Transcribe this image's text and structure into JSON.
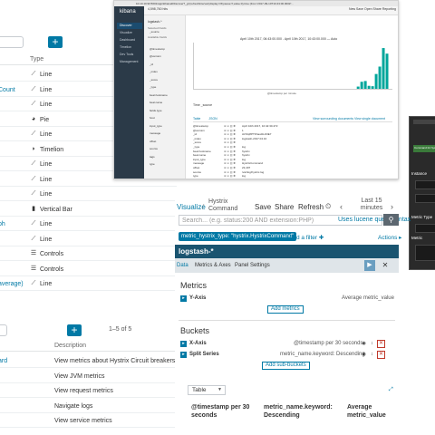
{
  "left_panel": {
    "column_type": "Type",
    "rows": [
      {
        "name": "",
        "type": "Line",
        "icon": "line-chart-icon"
      },
      {
        "name": "Count",
        "type": "Line",
        "icon": "line-chart-icon"
      },
      {
        "name": "",
        "type": "Line",
        "icon": "line-chart-icon"
      },
      {
        "name": "",
        "type": "Pie",
        "icon": "pie-chart-icon"
      },
      {
        "name": "",
        "type": "Line",
        "icon": "line-chart-icon"
      },
      {
        "name": "",
        "type": "Timelion",
        "icon": "timelion-icon"
      },
      {
        "name": "",
        "type": "Line",
        "icon": "line-chart-icon"
      },
      {
        "name": "",
        "type": "Line",
        "icon": "line-chart-icon"
      },
      {
        "name": "",
        "type": "Line",
        "icon": "line-chart-icon"
      },
      {
        "name": "",
        "type": "Vertical Bar",
        "icon": "bar-chart-icon"
      },
      {
        "name": "ph",
        "type": "Line",
        "icon": "line-chart-icon"
      },
      {
        "name": "",
        "type": "Line",
        "icon": "line-chart-icon"
      },
      {
        "name": "",
        "type": "Controls",
        "icon": "controls-icon"
      },
      {
        "name": "",
        "type": "Controls",
        "icon": "controls-icon"
      },
      {
        "name": "average)",
        "type": "Line",
        "icon": "line-chart-icon"
      }
    ],
    "add_label": "+"
  },
  "dashboard_panel": {
    "add_label": "+",
    "pager": "1–5 of 5",
    "column_description": "Description",
    "rows": [
      {
        "name": "ard",
        "description": "View metrics about Hystrix Circuit breakers"
      },
      {
        "name": "",
        "description": "View JVM metrics"
      },
      {
        "name": "",
        "description": "View request metrics"
      },
      {
        "name": "",
        "description": "Navigate logs"
      },
      {
        "name": "",
        "description": "View service metrics"
      }
    ]
  },
  "kibana_window": {
    "url": "10.10.10.90:5601/app/kibana#/discover?_g=(refreshInterval:(display:Off,pause:!f,value:0),time:(from:'2017-09-10T10:43:00.000Z'...",
    "logo": "kibana",
    "nav": [
      "Discover",
      "Visualize",
      "Dashboard",
      "Timelion",
      "Dev Tools",
      "Management"
    ],
    "hits": "4,598,760 hits",
    "actions": "New   Save   Open   Share   Reporting",
    "search_placeholder": "Search... (e.g. status:200 AND extension:PHP)",
    "index": "logstash-*",
    "fields_header_selected": "Selected Fields",
    "fields_header_available": "Available Fields",
    "fields": [
      "_source",
      "@timestamp",
      "@version",
      "_id",
      "_index",
      "_score",
      "_type",
      "beat.hostname",
      "beat.name",
      "fields.type",
      "host",
      "input_type",
      "message",
      "offset",
      "source",
      "tags",
      "type"
    ],
    "range": "April 10th 2017, 06:43:00.000 - April 10th 2017, 10:43:00.000 — Auto",
    "x_label": "@timestamp per minute",
    "doc_header": "Time                                     _source",
    "doc_tabs": [
      "Table",
      "JSON"
    ],
    "doc_tabs_right": "View surrounding documents   View single document",
    "doc_rows": [
      {
        "key": "@timestamp",
        "icons": "⊕ ⊖ ▥ ✱",
        "value": "April 10th 2017, 10:42:30.472"
      },
      {
        "key": "@version",
        "icons": "⊕ ⊖ ▥ ✱",
        "value": "1"
      },
      {
        "key": "_id",
        "icons": "⊕ ⊖ ▥ ✱",
        "value": "AVtXq8PTKhaxdtLJI0E7"
      },
      {
        "key": "_index",
        "icons": "⊕ ⊖ ▥ ✱",
        "value": "logstash-2017.04.10"
      },
      {
        "key": "_score",
        "icons": "⊕ ⊖ ▥ ✱",
        "value": ""
      },
      {
        "key": "_type",
        "icons": "⊕ ⊖ ▥ ✱",
        "value": "log"
      },
      {
        "key": "beat.hostname",
        "icons": "⊕ ⊖ ▥ ✱",
        "value": "hystrix"
      },
      {
        "key": "beat.name",
        "icons": "⊕ ⊖ ▥ ✱",
        "value": "hystrix"
      },
      {
        "key": "input_type",
        "icons": "⊕ ⊖ ▥ ✱",
        "value": "log"
      },
      {
        "key": "message",
        "icons": "⊕ ⊖ ▥ ✱",
        "value": "HystrixCommand"
      },
      {
        "key": "offset",
        "icons": "⊕ ⊖ ▥ ✱",
        "value": "23,497"
      },
      {
        "key": "source",
        "icons": "⊕ ⊖ ▥ ✱",
        "value": "/var/log/hystrix.log"
      },
      {
        "key": "type",
        "icons": "⊕ ⊖ ▥ ✱",
        "value": "log"
      }
    ]
  },
  "dark_window": {
    "green_text": "Command:14 hystrix",
    "labels": [
      "Instance",
      "Metric Type",
      "Metric"
    ]
  },
  "visualize": {
    "nav": {
      "visualize": "Visualize",
      "separator": "/",
      "crumb": "Hystrix Command",
      "save": "Save",
      "share": "Share",
      "refresh": "Refresh",
      "clock_icon": "clock-icon",
      "prev": "‹",
      "last": "Last 15 minutes",
      "next": "›"
    },
    "search": {
      "placeholder": "Search... (e.g. status:200 AND extension:PHP)",
      "lucene": "Uses lucene query syntax"
    },
    "filter": {
      "pill": "metric_hystrix_type: \"hystrix.HystrixCommand\"",
      "add": "Add a filter ✚",
      "actions": "Actions ▸"
    },
    "index": "logstash-*",
    "tabs": [
      "Data",
      "Metrics & Axes",
      "Panel Settings"
    ],
    "metrics": {
      "title": "Metrics",
      "y_axis": "Y-Axis",
      "y_axis_desc": "Average metric_value",
      "add": "Add metrics"
    },
    "buckets": {
      "title": "Buckets",
      "x_axis": "X-Axis",
      "x_axis_desc": "@timestamp per 30 seconds",
      "split": "Split Series",
      "split_desc": "metric_name.keyword: Descending",
      "add": "Add sub-buckets"
    },
    "table": {
      "select": "Table",
      "headers": [
        "@timestamp per 30 seconds",
        "metric_name.keyword: Descending",
        "Average metric_value"
      ]
    }
  },
  "chart_data": {
    "type": "bar",
    "xlabel": "@timestamp per minute",
    "categories": [
      "10:34",
      "10:35",
      "10:36",
      "10:37",
      "10:38",
      "10:39",
      "10:40",
      "10:41",
      "10:42"
    ],
    "values": [
      120,
      380,
      420,
      160,
      140,
      800,
      1200,
      2200,
      1900
    ],
    "bar_color": "#00a69b"
  }
}
